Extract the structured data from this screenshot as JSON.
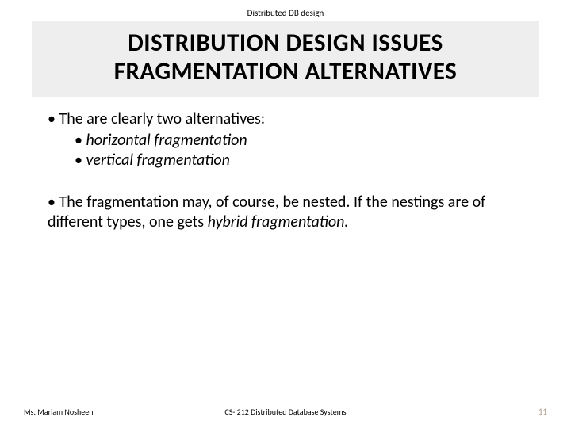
{
  "header_label": "Distributed DB design",
  "title_line1": "DISTRIBUTION DESIGN ISSUES",
  "title_line2": "FRAGMENTATION ALTERNATIVES",
  "bullets": {
    "b1": "• The are clearly two alternatives:",
    "b1a_prefix": "• ",
    "b1a_text": "horizontal fragmentation",
    "b1b_prefix": "• ",
    "b1b_text": "vertical fragmentation",
    "b2_prefix": "• The fragmentation may, of course, be nested. If the nestings are of different types, one gets ",
    "b2_italic": "hybrid fragmentation."
  },
  "footer": {
    "author": "Ms. Mariam Nosheen",
    "course": "CS- 212 Distributed Database Systems",
    "page": "11"
  }
}
